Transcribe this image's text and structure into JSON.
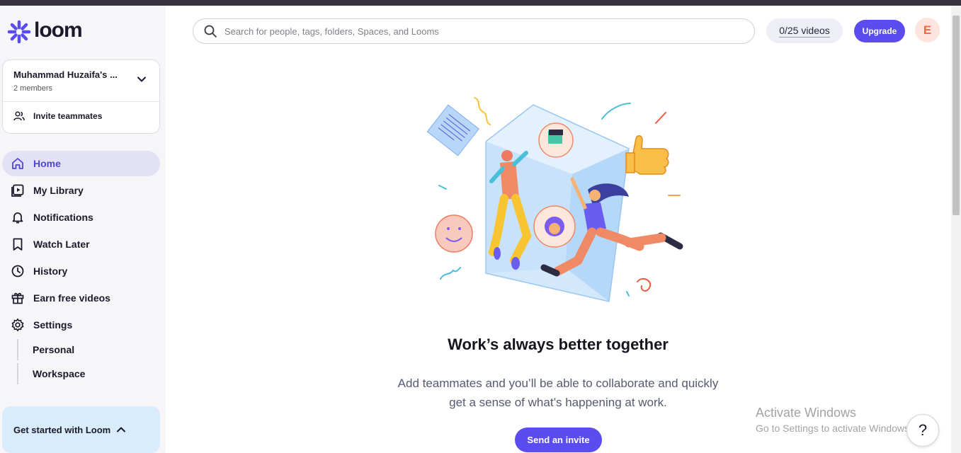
{
  "brand": {
    "name": "loom",
    "accent": "#5b4cf0"
  },
  "workspace": {
    "name": "Muhammad Huzaifa's ...",
    "members": "2 members",
    "invite_label": "Invite teammates"
  },
  "nav": {
    "items": [
      {
        "label": "Home",
        "icon": "home-icon",
        "active": true
      },
      {
        "label": "My Library",
        "icon": "library-icon"
      },
      {
        "label": "Notifications",
        "icon": "bell-icon"
      },
      {
        "label": "Watch Later",
        "icon": "bookmark-icon"
      },
      {
        "label": "History",
        "icon": "clock-icon"
      },
      {
        "label": "Earn free videos",
        "icon": "gift-icon"
      },
      {
        "label": "Settings",
        "icon": "gear-icon"
      }
    ],
    "settings_sub": [
      "Personal",
      "Workspace"
    ]
  },
  "get_started": {
    "label": "Get started with Loom"
  },
  "header": {
    "search_placeholder": "Search for people, tags, folders, Spaces, and Looms",
    "videos_count": "0/25 videos",
    "upgrade_label": "Upgrade",
    "avatar_initial": "E"
  },
  "main": {
    "heading": "Work’s always better together",
    "description_line1": "Add teammates and you’ll be able to collaborate and quickly",
    "description_line2": "get a sense of what’s happening at work.",
    "invite_button": "Send an invite"
  },
  "overlay": {
    "activate_title": "Activate Windows",
    "activate_sub": "Go to Settings to activate Windows.",
    "help_label": "?"
  }
}
